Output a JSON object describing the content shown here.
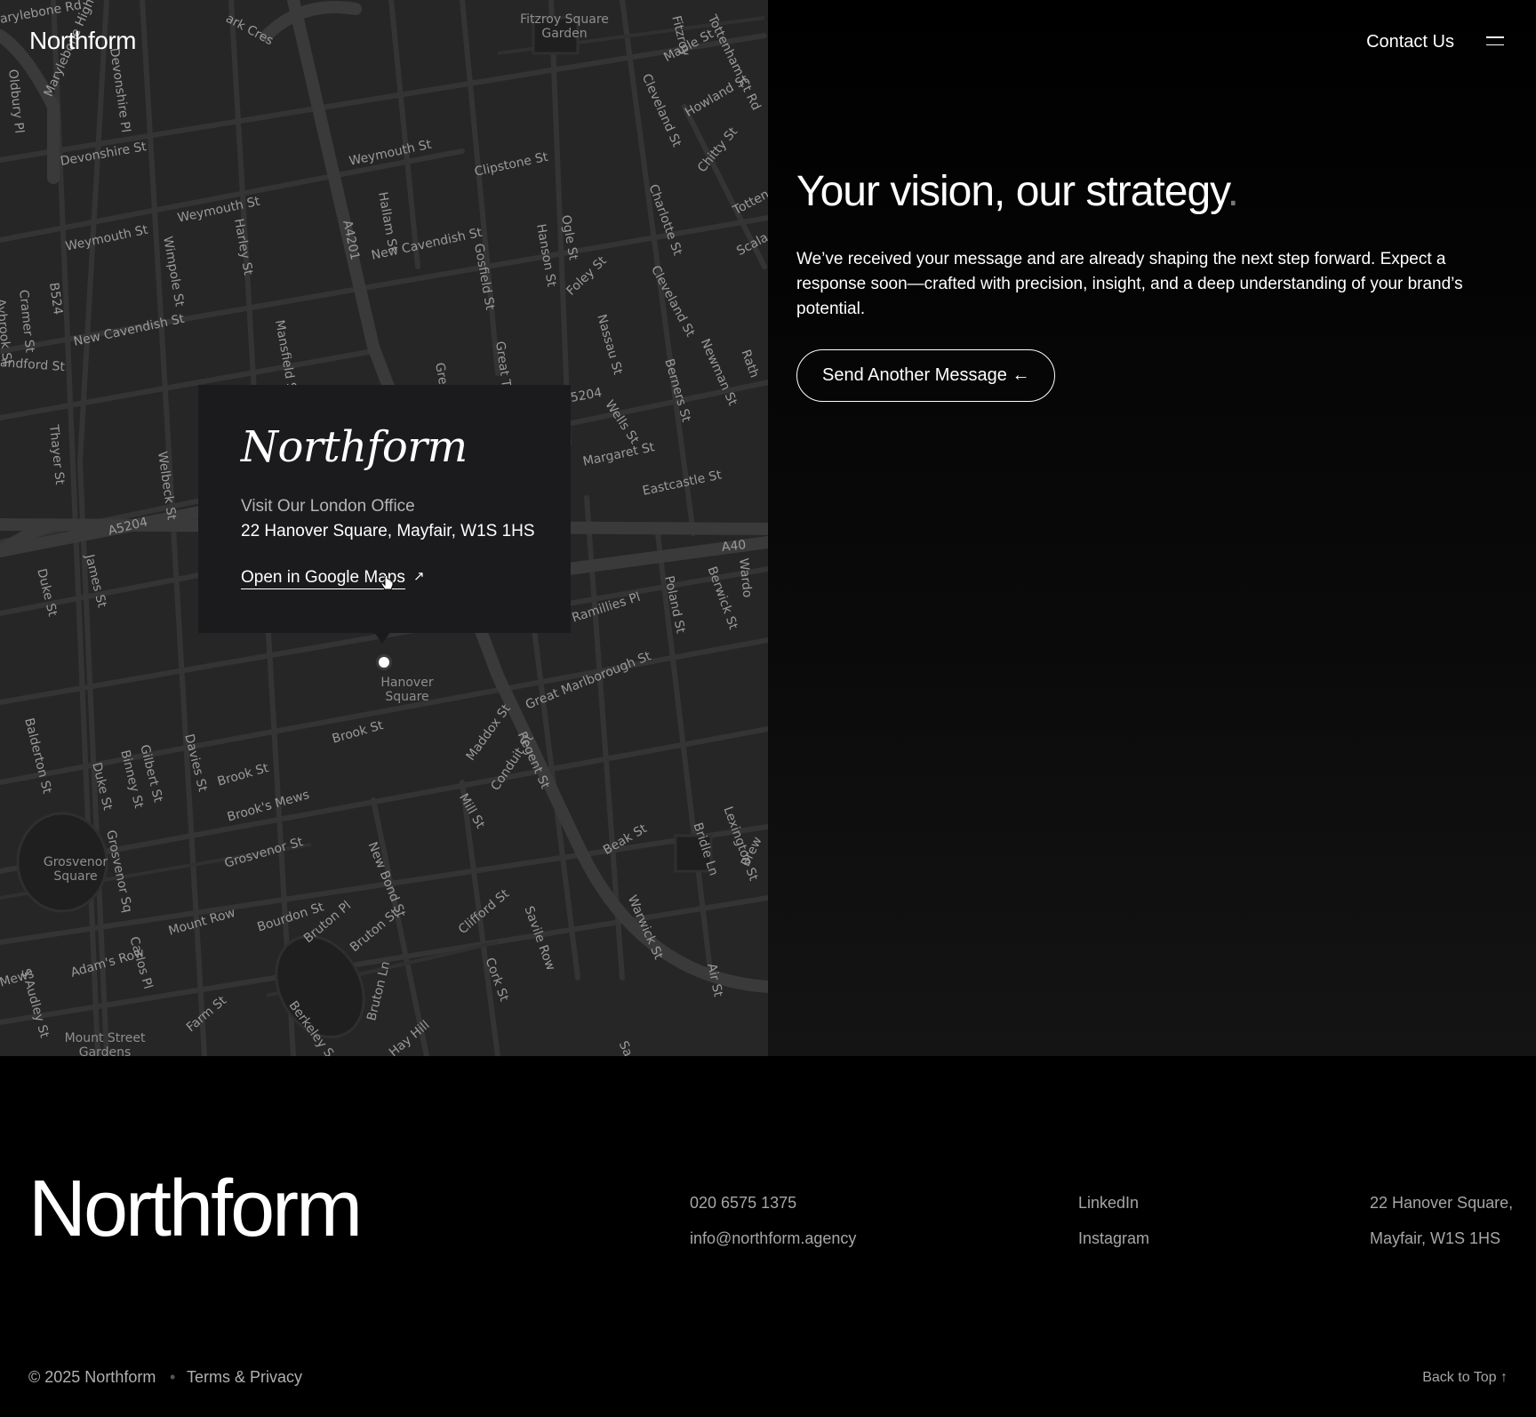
{
  "header": {
    "brand": "Northform",
    "contact_label": "Contact Us",
    "menu_icon": "hamburger-menu-icon"
  },
  "hero": {
    "headline": "Your vision, our strategy",
    "headline_dot": ".",
    "lead": "We’ve received your message and are already shaping the next step forward. Expect a response soon—crafted with precision, insight, and a deep understanding of your brand’s potential.",
    "send_again_label": "Send Another Message ←"
  },
  "map": {
    "card": {
      "brand": "Northform",
      "subtitle": "Visit Our London Office",
      "address": "22 Hanover Square, Mayfair, W1S 1HS",
      "link_label": "Open in Google Maps",
      "link_arrow": "↗"
    },
    "street_labels": [
      "arylebone Rd",
      "ark Cres",
      "Fitzroy Square",
      "Garden",
      "Maple St",
      "Tottenham Ct Rd",
      "Devonshire St",
      "Weymouth St",
      "Clipstone St",
      "Howland St",
      "Weymouth St",
      "Weymouth St",
      "New Cavendish St",
      "New Cavendish St",
      "A4201",
      "B524",
      "andford St",
      "Thayer St",
      "A5204",
      "Margaret St",
      "Eastcastle St",
      "A40",
      "Ramillies Pl",
      "Great Marlborough St",
      "Brook St",
      "Brook St",
      "Grosvenor St",
      "Mount Row",
      "Adam's Row",
      "Maddox St",
      "Regent St",
      "Beak St",
      "Clifford St",
      "Bourdon St",
      "Bruton Pl",
      "Bruton St",
      "Farm St",
      "Hay Hill",
      "Mews",
      "Hanover",
      "Square",
      "Grosvenor",
      "Square",
      "Mount Street",
      "Gardens",
      "Welbeck St",
      "Wimpole St",
      "Harley St",
      "Gosfield St",
      "Hanson St",
      "Ogle St",
      "Foley St",
      "Cleveland St",
      "Nassau St",
      "Berners St",
      "Newman St",
      "Wells St",
      "Poland St",
      "Berwick St",
      "Duke St",
      "James St",
      "Balderton St",
      "Gilbert St",
      "Binney St",
      "Davies St",
      "Duke St",
      "Mill St",
      "Conduit St",
      "New Bond St",
      "Savile Row",
      "Cork St",
      "Warwick St",
      "Bridle Ln",
      "Lexington St",
      "Sackville St",
      "Carlos Pl",
      "S Audley St",
      "Berkeley Square",
      "Bruton Ln",
      "Great Portland St",
      "Great Titchfield St",
      "Mansfield St",
      "Hallam St",
      "Charlotte St",
      "Chitty St",
      "Cleveland St",
      "5204",
      "Brook's Mews",
      "Grosvenor Sq",
      "Air St",
      "Brew",
      "Wardo",
      "Rath",
      "Scala",
      "Totten",
      "Fitzroy",
      "Oldbury Pl",
      "Devonshire Pl",
      "Marylebone High St",
      "Cramer St",
      "Aybrook St"
    ]
  },
  "footer": {
    "logo": "Northform",
    "phone": "020 6575 1375",
    "email": "info@northform.agency",
    "social": [
      "LinkedIn",
      "Instagram"
    ],
    "address_line1": "22 Hanover Square,",
    "address_line2": "Mayfair, W1S 1HS",
    "copyright": "© 2025 Northform",
    "separator": "•",
    "terms": "Terms & Privacy",
    "back_to_top": "Back to Top ↑"
  }
}
